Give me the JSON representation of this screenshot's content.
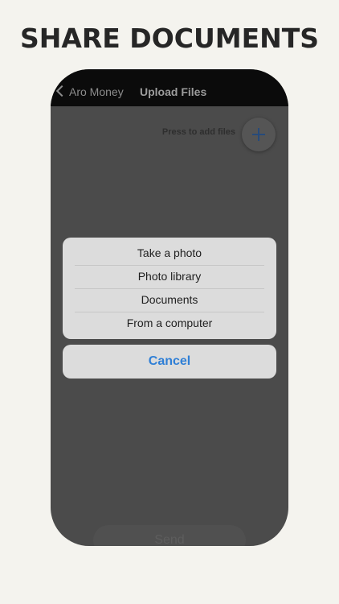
{
  "headline": "SHARE DOCUMENTS",
  "navbar": {
    "back_label": "Aro Money",
    "title": "Upload Files"
  },
  "upload": {
    "hint": "Press to add files",
    "add_icon": "plus-icon"
  },
  "action_sheet": {
    "items": [
      {
        "label": "Take a photo"
      },
      {
        "label": "Photo library"
      },
      {
        "label": "Documents"
      },
      {
        "label": "From a computer"
      }
    ],
    "cancel_label": "Cancel"
  },
  "footer": {
    "send_label": "Send"
  },
  "colors": {
    "background": "#f4f3ee",
    "overlay": "#4b4b4b",
    "sheet": "#dcdcdc",
    "cancel_accent": "#2f7fd6"
  }
}
